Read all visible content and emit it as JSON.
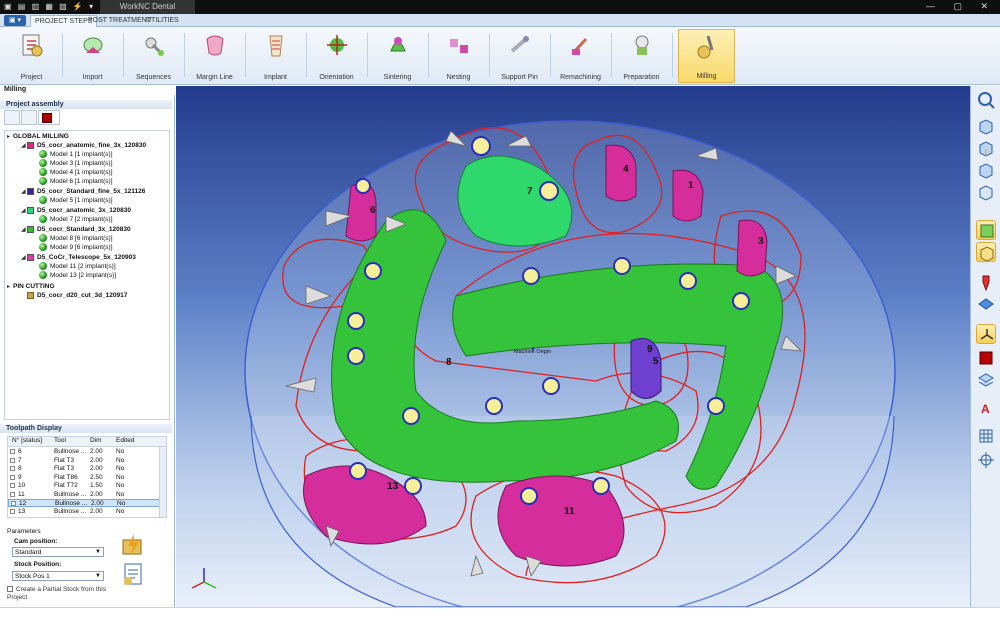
{
  "window": {
    "title": "WorkNC Dental",
    "quick_access": "▣ ▤ ▥ ▦ ▧ ⚡ ▾"
  },
  "app_button": "▣ ▾",
  "tabs": [
    "PROJECT STEPS",
    "POST TREATMENT",
    "UTILITIES"
  ],
  "ribbon": [
    {
      "label": "Project",
      "icon": "project-icon"
    },
    {
      "label": "Import",
      "icon": "import-icon"
    },
    {
      "label": "Sequences",
      "icon": "sequences-icon"
    },
    {
      "label": "Margin Line",
      "icon": "margin-line-icon"
    },
    {
      "label": "Implant",
      "icon": "implant-icon"
    },
    {
      "label": "Orientation",
      "icon": "orientation-icon"
    },
    {
      "label": "Sintering",
      "icon": "sintering-icon"
    },
    {
      "label": "Nesting",
      "icon": "nesting-icon"
    },
    {
      "label": "Support Pin",
      "icon": "support-pin-icon"
    },
    {
      "label": "Remachining",
      "icon": "remachining-icon"
    },
    {
      "label": "Preparation",
      "icon": "preparation-icon"
    },
    {
      "label": "Milling",
      "icon": "milling-icon",
      "active": true
    }
  ],
  "section_label": "Milling",
  "project_assembly": {
    "header": "Project assembly",
    "global_milling": "GLOBAL MILLING",
    "groups": [
      {
        "name": "D5_cocr_anatomic_fine_3x_120830",
        "color": "#e0287e",
        "models": [
          "Model 1 [1 implant(s)]",
          "Model 3 [1 implant(s)]",
          "Model 4 [1 implant(s)]",
          "Model 6 [1 implant(s)]"
        ]
      },
      {
        "name": "D5_cocr_Standard_fine_5x_121126",
        "color": "#2e1fb8",
        "models": [
          "Model 5 [1 implant(s)]"
        ]
      },
      {
        "name": "D5_cocr_anatomic_3x_120830",
        "color": "#34d17c",
        "models": [
          "Model 7 [2 implant(s)]"
        ]
      },
      {
        "name": "D5_cocr_Standard_3x_120830",
        "color": "#2fbf2f",
        "models": [
          "Model 8 [6 implant(s)]",
          "Model 9 [6 implant(s)]"
        ]
      },
      {
        "name": "D5_CoCr_Telescope_5x_120903",
        "color": "#e03cb0",
        "models": [
          "Model 11 [2 implant(s)]",
          "Model 13 [2 implant(s)]"
        ]
      }
    ],
    "pin_cutting": "PIN CUTTING",
    "pin_item": "D5_cocr_d20_cut_3d_120917"
  },
  "toolpath_display": {
    "header": "Toolpath Display",
    "columns": [
      "N° [status]",
      "Tool",
      "Dim",
      "Edited"
    ],
    "rows": [
      {
        "n": "6",
        "tool": "Bullnose ...",
        "dim": "2.00",
        "edited": "No"
      },
      {
        "n": "7",
        "tool": "Flat T3",
        "dim": "2.00",
        "edited": "No"
      },
      {
        "n": "8",
        "tool": "Flat T3",
        "dim": "2.00",
        "edited": "No"
      },
      {
        "n": "9",
        "tool": "Flat T86",
        "dim": "2.50",
        "edited": "No"
      },
      {
        "n": "10",
        "tool": "Flat T72",
        "dim": "1.50",
        "edited": "No"
      },
      {
        "n": "11",
        "tool": "Bullnose ...",
        "dim": "2.00",
        "edited": "No"
      },
      {
        "n": "12",
        "tool": "Bullnose ...",
        "dim": "2.00",
        "edited": "No",
        "selected": true
      },
      {
        "n": "13",
        "tool": "Bullnose ...",
        "dim": "2.00",
        "edited": "No"
      }
    ]
  },
  "parameters": {
    "header": "Parameters",
    "cam_position_label": "Cam position:",
    "cam_position_value": "Standard",
    "stock_position_label": "Stock Position:",
    "stock_position_value": "Stock Pos 1",
    "partial_stock_label": "Create a Partial Stock from this Project"
  },
  "viewport": {
    "machine_origin": "Machine Origin",
    "model_labels": [
      "1",
      "3",
      "4",
      "5",
      "6",
      "7",
      "8",
      "9",
      "11",
      "13"
    ]
  },
  "colors": {
    "accent": "#f9d96a",
    "viewport_top": "#233b8c",
    "toolpath": "#e02020",
    "bridge": "#2ecc40",
    "magenta": "#d62d9c"
  }
}
